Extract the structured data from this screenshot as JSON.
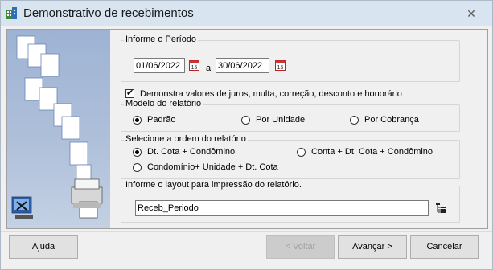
{
  "window": {
    "title": "Demonstrativo de recebimentos",
    "close_glyph": "✕"
  },
  "period": {
    "legend": "Informe o Período",
    "start_date": "01/06/2022",
    "separator": "a",
    "end_date": "30/06/2022",
    "calendar_icon_text": "15"
  },
  "options": {
    "show_values_label": "Demonstra valores de juros, multa, correção, desconto e honorário",
    "show_values_checked": true
  },
  "model": {
    "legend": "Modelo do relatório",
    "options": [
      "Padrão",
      "Por Unidade",
      "Por Cobrança"
    ],
    "selected": "Padrão"
  },
  "order": {
    "legend": "Selecione a ordem do relatório",
    "options": [
      "Dt. Cota + Condômino",
      "Conta + Dt. Cota + Condômino",
      "Condomínio+ Unidade + Dt. Cota"
    ],
    "selected": "Dt. Cota + Condômino"
  },
  "layout": {
    "legend": "Informe o layout para impressão do relatório.",
    "value": "Receb_Periodo"
  },
  "buttons": {
    "help": "Ajuda",
    "back": "< Voltar",
    "next": "Avançar >",
    "cancel": "Cancelar"
  }
}
